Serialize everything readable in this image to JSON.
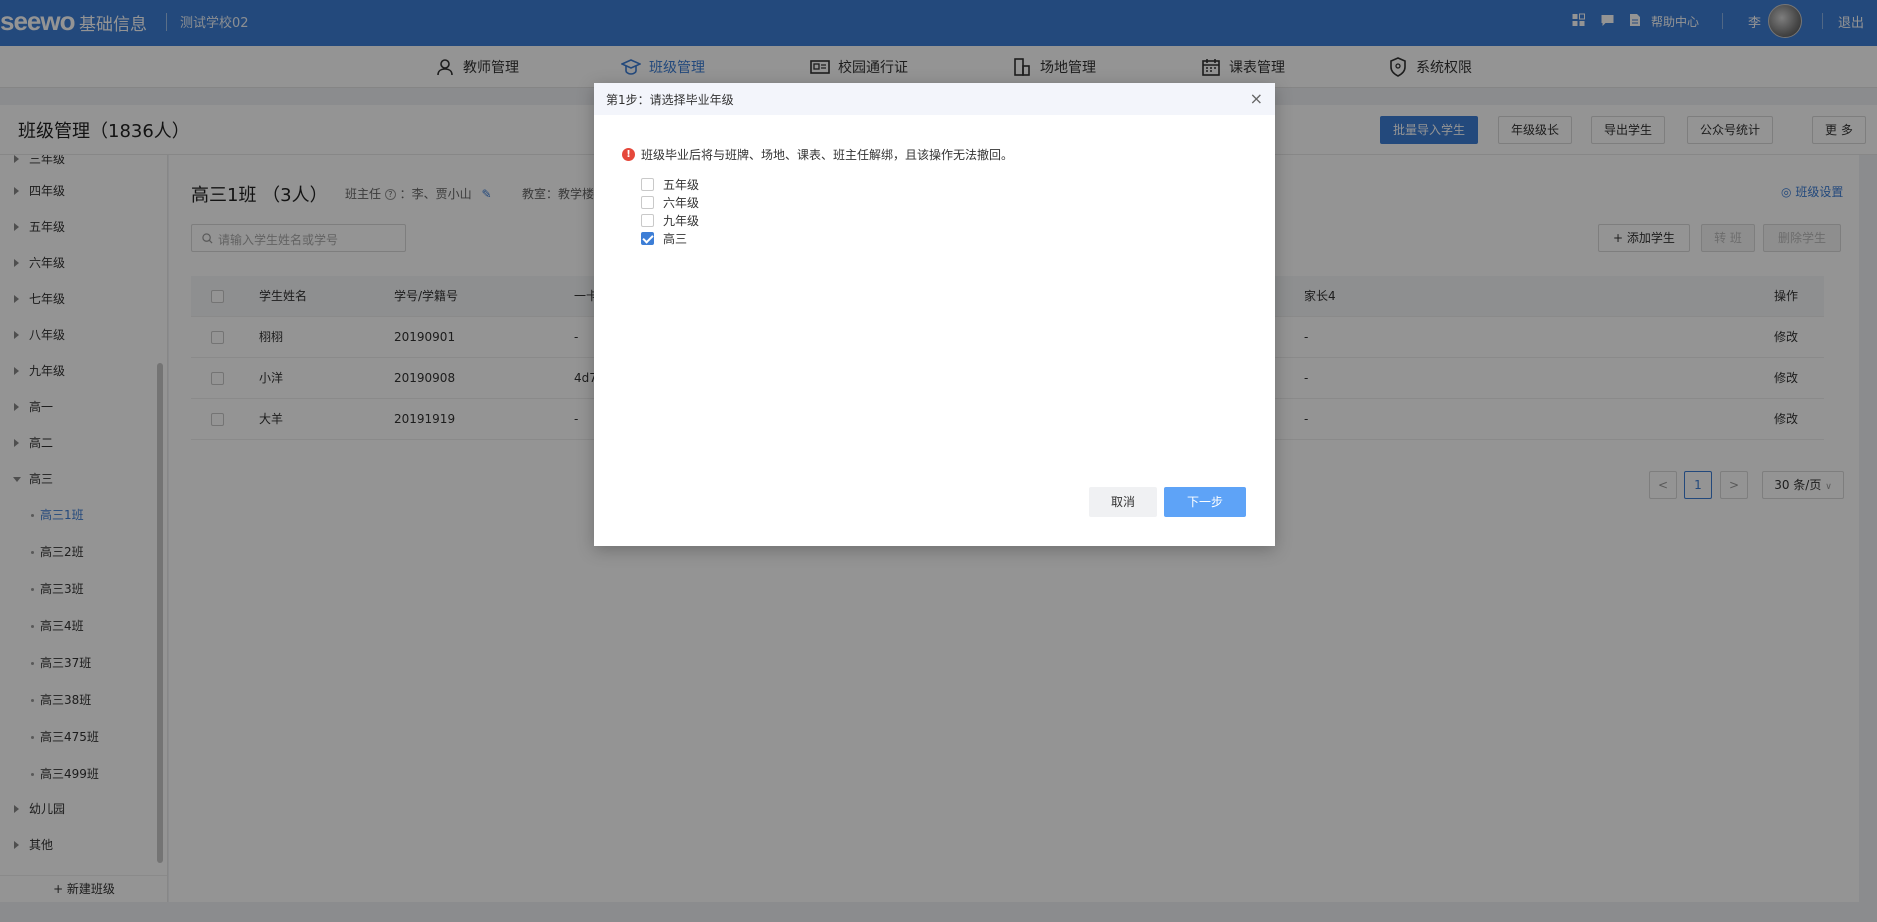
{
  "header": {
    "logo": "seewo",
    "product": "基础信息",
    "school": "测试学校02",
    "help": "帮助中心",
    "user": "李",
    "logout": "退出"
  },
  "nav": [
    {
      "label": "教师管理",
      "icon": "user-icon"
    },
    {
      "label": "班级管理",
      "icon": "graduation-cap-icon"
    },
    {
      "label": "校园通行证",
      "icon": "id-card-icon"
    },
    {
      "label": "场地管理",
      "icon": "building-icon"
    },
    {
      "label": "课表管理",
      "icon": "calendar-icon"
    },
    {
      "label": "系统权限",
      "icon": "shield-icon"
    }
  ],
  "page": {
    "title": "班级管理（1836人）",
    "buttons": [
      "批量导入学生",
      "年级级长",
      "导出学生",
      "公众号统计",
      "更 多"
    ]
  },
  "sidebar": {
    "items": [
      {
        "label": "三年级",
        "type": "grade"
      },
      {
        "label": "四年级",
        "type": "grade"
      },
      {
        "label": "五年级",
        "type": "grade"
      },
      {
        "label": "六年级",
        "type": "grade"
      },
      {
        "label": "七年级",
        "type": "grade"
      },
      {
        "label": "八年级",
        "type": "grade"
      },
      {
        "label": "九年级",
        "type": "grade"
      },
      {
        "label": "高一",
        "type": "grade"
      },
      {
        "label": "高二",
        "type": "grade"
      },
      {
        "label": "高三",
        "type": "grade-open"
      },
      {
        "label": "高三1班",
        "type": "class-selected"
      },
      {
        "label": "高三2班",
        "type": "class"
      },
      {
        "label": "高三3班",
        "type": "class"
      },
      {
        "label": "高三4班",
        "type": "class"
      },
      {
        "label": "高三37班",
        "type": "class"
      },
      {
        "label": "高三38班",
        "type": "class"
      },
      {
        "label": "高三475班",
        "type": "class"
      },
      {
        "label": "高三499班",
        "type": "class"
      },
      {
        "label": "幼儿园",
        "type": "grade"
      },
      {
        "label": "其他",
        "type": "grade"
      }
    ],
    "new_class": "+ 新建班级"
  },
  "content": {
    "class_title": "高三1班 （3人）",
    "teacher_label": "班主任",
    "teacher_value": "：李、贾小山",
    "room_label": "教室：教学楼",
    "settings": "班级设置",
    "search_placeholder": "请输入学生姓名或学号",
    "add_student": "+ 添加学生",
    "transfer": "转 班",
    "delete_student": "删除学生",
    "columns": {
      "name": "学生姓名",
      "id": "学号/学籍号",
      "col3": "一卡",
      "parent4": "家长4",
      "action": "操作"
    },
    "rows": [
      {
        "name": "栩栩",
        "id": "20190901",
        "col3": "-",
        "parent4": "-",
        "action": "修改"
      },
      {
        "name": "小洋",
        "id": "20190908",
        "col3": "4d7",
        "parent4": "-",
        "action": "修改"
      },
      {
        "name": "大羊",
        "id": "20191919",
        "col3": "-",
        "parent4": "-",
        "action": "修改"
      }
    ],
    "pager": {
      "prev": "<",
      "page": "1",
      "next": ">",
      "size": "30 条/页"
    }
  },
  "modal": {
    "title": "第1步：请选择毕业年级",
    "close": "×",
    "warning": "班级毕业后将与班牌、场地、课表、班主任解绑，且该操作无法撤回。",
    "options": [
      {
        "label": "五年级",
        "checked": false
      },
      {
        "label": "六年级",
        "checked": false
      },
      {
        "label": "九年级",
        "checked": false
      },
      {
        "label": "高三",
        "checked": true
      }
    ],
    "cancel": "取消",
    "next": "下一步"
  },
  "colors": {
    "brand": "#3d7ed6",
    "next_button": "#5ea3f7",
    "warning": "#e5483b"
  }
}
